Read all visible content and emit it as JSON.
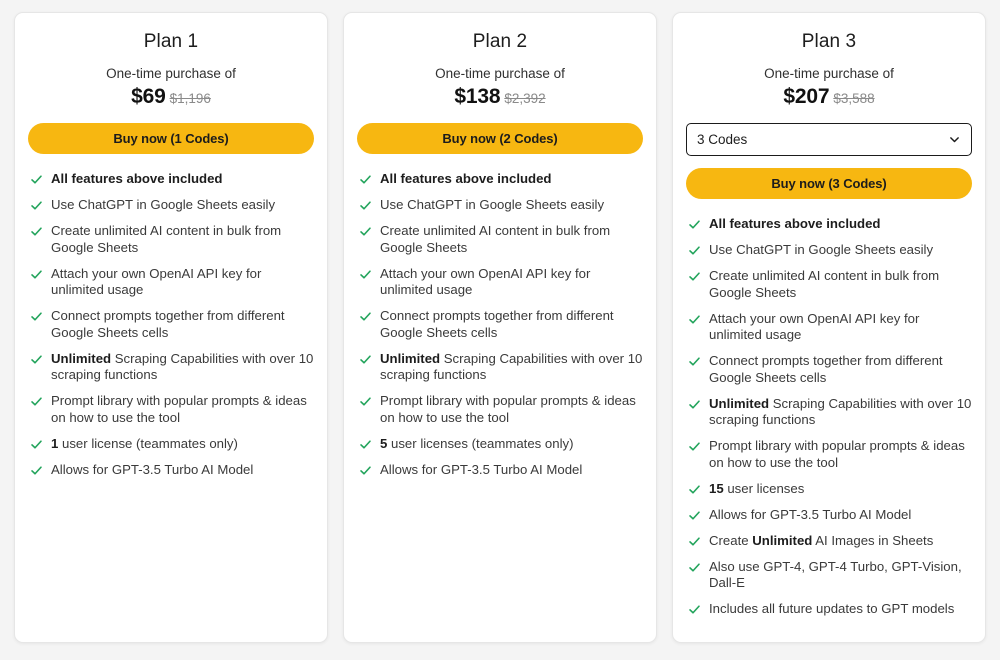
{
  "icons": {
    "check": "check-icon",
    "chevron_down": "chevron-down-icon"
  },
  "colors": {
    "page_background": "#f4f4f4",
    "card_background": "#ffffff",
    "buy_button": "#f7b711",
    "check_green": "#23a45c",
    "strikethrough_price": "#8a8a8a"
  },
  "plans": [
    {
      "title": "Plan 1",
      "subtitle": "One-time purchase of",
      "price": "$69",
      "original_price": "$1,196",
      "has_code_selector": false,
      "buy_label": "Buy now (1 Codes)",
      "features": [
        {
          "text": "All features above included",
          "bold_all": true
        },
        {
          "text": "Use ChatGPT in Google Sheets easily"
        },
        {
          "text": "Create unlimited AI content in bulk from Google Sheets"
        },
        {
          "text": "Attach your own OpenAI API key for unlimited usage"
        },
        {
          "text": "Connect prompts together from different Google Sheets cells"
        },
        {
          "bold_prefix": "Unlimited",
          "text": " Scraping Capabilities with over 10 scraping functions"
        },
        {
          "text": "Prompt library with popular prompts & ideas on how to use the tool"
        },
        {
          "bold_prefix": "1",
          "text": " user license (teammates only)"
        },
        {
          "text": "Allows for GPT-3.5 Turbo AI Model"
        }
      ]
    },
    {
      "title": "Plan 2",
      "subtitle": "One-time purchase of",
      "price": "$138",
      "original_price": "$2,392",
      "has_code_selector": false,
      "buy_label": "Buy now (2 Codes)",
      "features": [
        {
          "text": "All features above included",
          "bold_all": true
        },
        {
          "text": "Use ChatGPT in Google Sheets easily"
        },
        {
          "text": "Create unlimited AI content in bulk from Google Sheets"
        },
        {
          "text": "Attach your own OpenAI API key for unlimited usage"
        },
        {
          "text": "Connect prompts together from different Google Sheets cells"
        },
        {
          "bold_prefix": "Unlimited",
          "text": " Scraping Capabilities with over 10 scraping functions"
        },
        {
          "text": "Prompt library with popular prompts & ideas on how to use the tool"
        },
        {
          "bold_prefix": "5",
          "text": " user licenses (teammates only)"
        },
        {
          "text": "Allows for GPT-3.5 Turbo AI Model"
        }
      ]
    },
    {
      "title": "Plan 3",
      "subtitle": "One-time purchase of",
      "price": "$207",
      "original_price": "$3,588",
      "has_code_selector": true,
      "code_selector_value": "3 Codes",
      "buy_label": "Buy now (3 Codes)",
      "features": [
        {
          "text": "All features above included",
          "bold_all": true
        },
        {
          "text": "Use ChatGPT in Google Sheets easily"
        },
        {
          "text": "Create unlimited AI content in bulk from Google Sheets"
        },
        {
          "text": "Attach your own OpenAI API key for unlimited usage"
        },
        {
          "text": "Connect prompts together from different Google Sheets cells"
        },
        {
          "bold_prefix": "Unlimited",
          "text": " Scraping Capabilities with over 10 scraping functions"
        },
        {
          "text": "Prompt library with popular prompts & ideas on how to use the tool"
        },
        {
          "bold_prefix": "15",
          "text": " user licenses"
        },
        {
          "text": "Allows for GPT-3.5 Turbo AI Model"
        },
        {
          "text_before": "Create ",
          "bold_prefix": "Unlimited",
          "text": " AI Images in Sheets"
        },
        {
          "text": "Also use GPT-4, GPT-4 Turbo, GPT-Vision, Dall-E"
        },
        {
          "text": "Includes all future updates to GPT models"
        }
      ]
    }
  ]
}
